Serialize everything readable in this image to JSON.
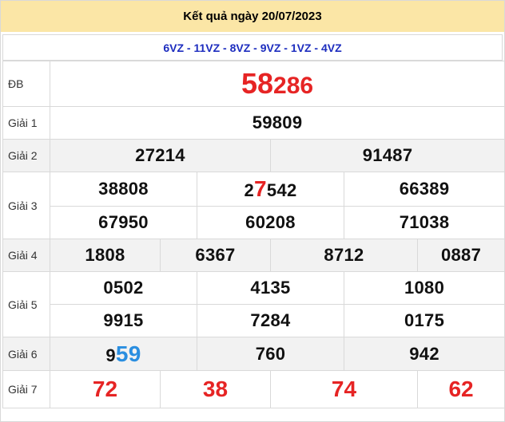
{
  "header": {
    "title": "Kết quả ngày 20/07/2023"
  },
  "codes": "6VZ - 11VZ - 8VZ - 9VZ - 1VZ - 4VZ",
  "rows": {
    "db": {
      "label": "ĐB",
      "prefix": "58",
      "suffix": "286"
    },
    "g1": {
      "label": "Giải 1",
      "values": [
        "59809"
      ]
    },
    "g2": {
      "label": "Giải 2",
      "values": [
        "27214",
        "91487"
      ]
    },
    "g3": {
      "label": "Giải 3",
      "r1": {
        "v1": "38808",
        "v2a": "2",
        "v2b": "7",
        "v2c": "542",
        "v3": "66389"
      },
      "r2": [
        "67950",
        "60208",
        "71038"
      ]
    },
    "g4": {
      "label": "Giải 4",
      "values": [
        "1808",
        "6367",
        "8712",
        "0887"
      ]
    },
    "g5": {
      "label": "Giải 5",
      "r1": [
        "0502",
        "4135",
        "1080"
      ],
      "r2": [
        "9915",
        "7284",
        "0175"
      ]
    },
    "g6": {
      "label": "Giải 6",
      "v1a": "9",
      "v1b": "59",
      "v2": "760",
      "v3": "942"
    },
    "g7": {
      "label": "Giải 7",
      "values": [
        "72",
        "38",
        "74",
        "62"
      ]
    }
  },
  "colors": {
    "header_bg": "#fbe6a6",
    "accent_red": "#e62424",
    "accent_blue": "#2a8ee0",
    "code_blue": "#1d2dbf"
  }
}
